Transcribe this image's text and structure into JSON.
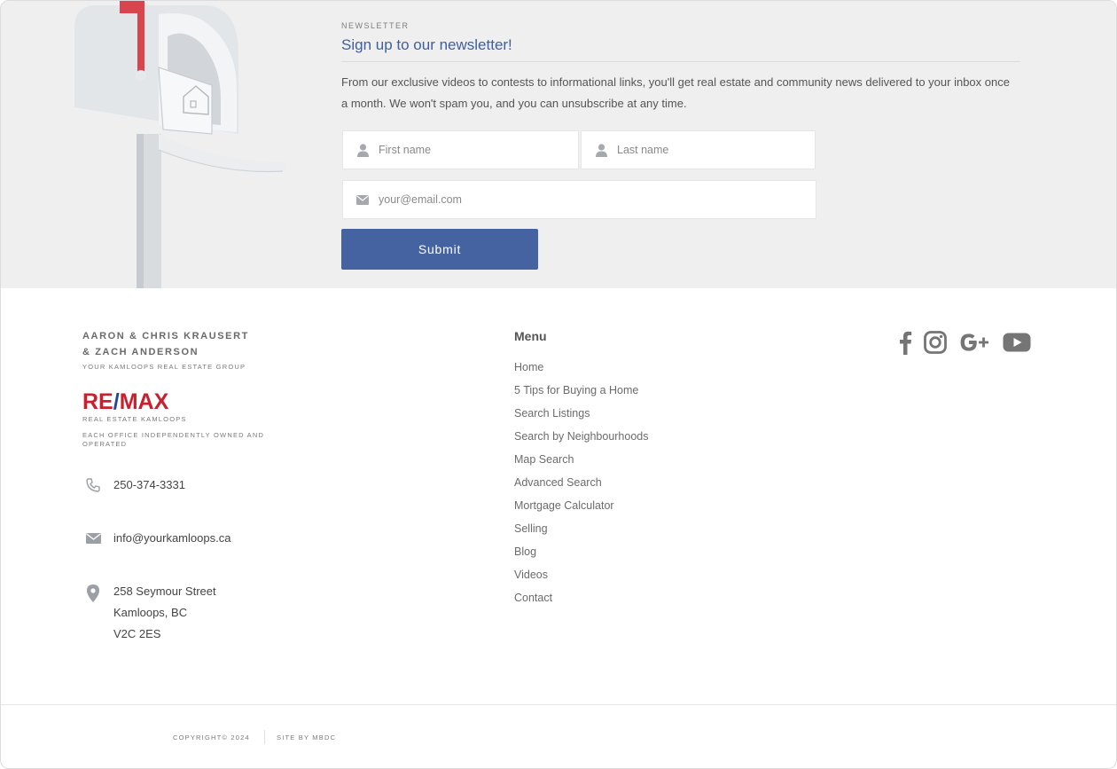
{
  "newsletter": {
    "eyebrow": "NEWSLETTER",
    "title": "Sign up to our newsletter!",
    "description": "From our exclusive videos to contests to informational links, you'll get real estate and community news delivered to your inbox once a month. We won't spam you, and you can unsubscribe at any time.",
    "first_name_placeholder": "First name",
    "last_name_placeholder": "Last name",
    "email_placeholder": "your@email.com",
    "submit_label": "Submit"
  },
  "brand": {
    "name_line1": "AARON & CHRIS KRAUSERT",
    "name_line2": "& ZACH ANDERSON",
    "tagline": "YOUR KAMLOOPS REAL ESTATE GROUP",
    "logo_text_a": "RE",
    "logo_text_slash": "/",
    "logo_text_b": "MAX",
    "logo_sub": "REAL ESTATE KAMLOOPS",
    "office_note": "EACH OFFICE INDEPENDENTLY OWNED AND OPERATED"
  },
  "contact": {
    "phone": "250-374-3331",
    "email": "info@yourkamloops.ca",
    "address_line1": "258 Seymour Street",
    "address_line2": "Kamloops, BC",
    "address_line3": "V2C 2ES"
  },
  "menu": {
    "title": "Menu",
    "items": [
      "Home",
      "5 Tips for Buying a Home",
      "Search Listings",
      "Search by Neighbourhoods",
      "Map Search",
      "Advanced Search",
      "Mortgage Calculator",
      "Selling",
      "Blog",
      "Videos",
      "Contact"
    ]
  },
  "social": {
    "icons": [
      "facebook-icon",
      "instagram-icon",
      "google-plus-icon",
      "youtube-icon"
    ],
    "color": "#757575"
  },
  "footer": {
    "copyright": "COPYRIGHT© 2024",
    "site_by": "SITE BY MBDC"
  },
  "colors": {
    "accent": "#4563a0",
    "title_blue": "#3f5f9e",
    "remax_red": "#c8202f",
    "remax_blue": "#1e4a9b",
    "band_bg": "#efefef"
  }
}
